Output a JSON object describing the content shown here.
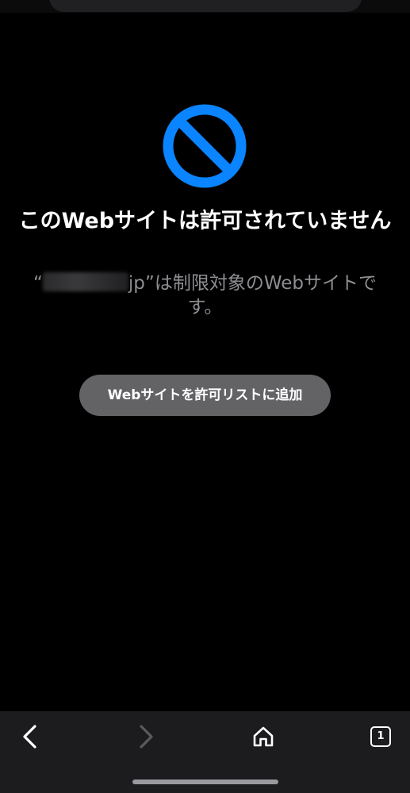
{
  "blocked_page": {
    "title": "このWebサイトは許可されていません",
    "description_prefix": "“",
    "description_suffix": "jp”は制限対象のWebサイトです。",
    "allow_button_label": "Webサイトを許可リストに追加"
  },
  "toolbar": {
    "tabs_count": "1"
  },
  "icons": {
    "blocked": "prohibited-icon",
    "back": "chevron-left-icon",
    "forward": "chevron-right-icon",
    "home": "home-icon",
    "tabs": "tabs-icon"
  },
  "colors": {
    "accent": "#0a84ff",
    "background": "#000000",
    "button": "#636366",
    "secondary_text": "#8e8e93"
  }
}
